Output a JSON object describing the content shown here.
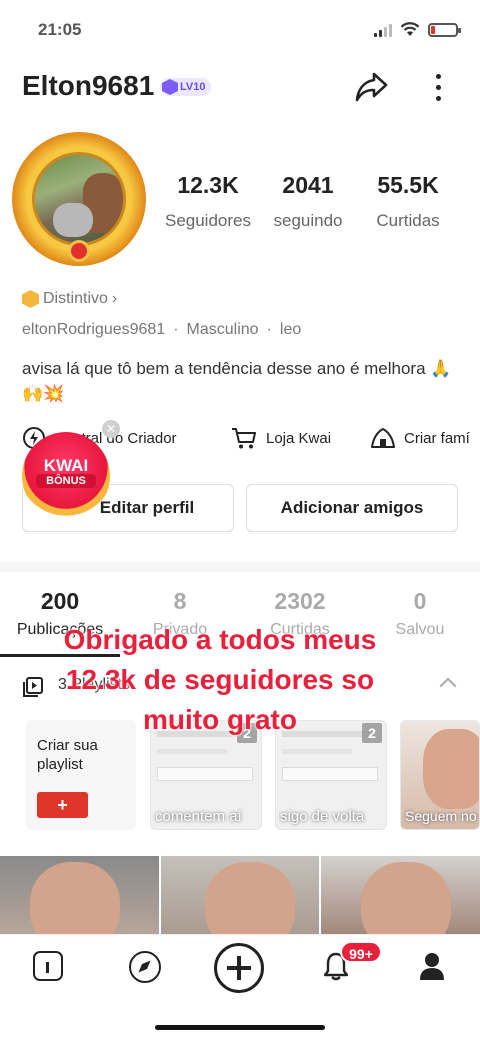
{
  "status_bar": {
    "time": "21:05"
  },
  "header": {
    "username": "Elton9681",
    "level": "LV10"
  },
  "stats": [
    {
      "value": "12.3K",
      "label": "Seguidores"
    },
    {
      "value": "2041",
      "label": "seguindo"
    },
    {
      "value": "55.5K",
      "label": "Curtidas"
    }
  ],
  "profile": {
    "badge_label": "Distintivo",
    "handle": "eltonRodrigues9681",
    "gender": "Masculino",
    "zodiac": "leo",
    "bio": "avisa lá que tô bem a tendência desse ano é melhora 🙏🙌💥"
  },
  "shortcuts": [
    {
      "label": "Central do Criador",
      "icon": "lightning-icon"
    },
    {
      "label": "Loja Kwai",
      "icon": "cart-icon"
    },
    {
      "label": "Criar famí",
      "icon": "family-house-icon"
    }
  ],
  "kwai_bonus": {
    "line1": "KWAI",
    "line2": "BÔNUS"
  },
  "buttons": {
    "edit_profile": "Editar perfil",
    "add_friends": "Adicionar amigos"
  },
  "tabs": [
    {
      "count": "200",
      "label": "Publicações",
      "active": true
    },
    {
      "count": "8",
      "label": "Privado",
      "active": false
    },
    {
      "count": "2302",
      "label": "Curtidas",
      "active": false
    },
    {
      "count": "0",
      "label": "Salvou",
      "active": false
    }
  ],
  "playlists": {
    "label": "3 Playlists",
    "create_label": "Criar sua playlist",
    "create_button": "+",
    "items": [
      {
        "count": "2",
        "caption": "comentem aí"
      },
      {
        "count": "2",
        "caption": "sigo de volta"
      },
      {
        "count": "",
        "caption": "Seguem no insta elton"
      }
    ]
  },
  "overlay_text": "Obrigado a todos meus 12.3k de seguidores so muito grato",
  "bottom_nav": {
    "notifications_badge": "99+"
  },
  "colors": {
    "accent": "#e0352b",
    "overlay_text": "#e8203b",
    "level_badge": "#7b5cf5"
  }
}
